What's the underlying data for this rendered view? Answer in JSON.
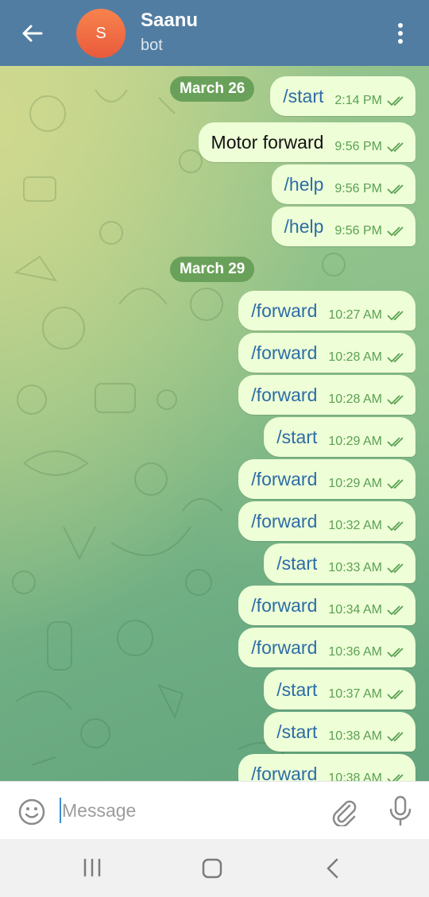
{
  "header": {
    "back_icon": "arrow-left-icon",
    "avatar_initial": "S",
    "title": "Saanu",
    "subtitle": "bot",
    "menu_icon": "more-vertical-icon",
    "color": "#517da2",
    "avatar_color": "#ee6a40"
  },
  "chat": {
    "dates": [
      "March 26",
      "March 29"
    ],
    "messages": [
      {
        "text": "/start",
        "time": "2:14 PM"
      },
      {
        "text": "Motor forward",
        "time": "9:56 PM"
      },
      {
        "text": "/help",
        "time": "9:56 PM"
      },
      {
        "text": "/help",
        "time": "9:56 PM"
      },
      {
        "text": "/forward",
        "time": "10:27 AM"
      },
      {
        "text": "/forward",
        "time": "10:28 AM"
      },
      {
        "text": "/forward",
        "time": "10:28 AM"
      },
      {
        "text": "/start",
        "time": "10:29 AM"
      },
      {
        "text": "/forward",
        "time": "10:29 AM"
      },
      {
        "text": "/forward",
        "time": "10:32 AM"
      },
      {
        "text": "/start",
        "time": "10:33 AM"
      },
      {
        "text": "/forward",
        "time": "10:34 AM"
      },
      {
        "text": "/forward",
        "time": "10:36 AM"
      },
      {
        "text": "/start",
        "time": "10:37 AM"
      },
      {
        "text": "/start",
        "time": "10:38 AM"
      },
      {
        "text": "/forward",
        "time": "10:38 AM"
      }
    ],
    "read_icon": "double-check-icon",
    "bubble_color": "#eefed7",
    "command_color": "#2b6da5",
    "time_color": "#5aa152"
  },
  "input": {
    "placeholder": "Message",
    "emoji_icon": "emoji-icon",
    "attach_icon": "paperclip-icon",
    "mic_icon": "microphone-icon"
  },
  "navbar": {
    "recent_icon": "recent-apps-icon",
    "home_icon": "home-icon",
    "back_icon": "back-chevron-icon"
  }
}
